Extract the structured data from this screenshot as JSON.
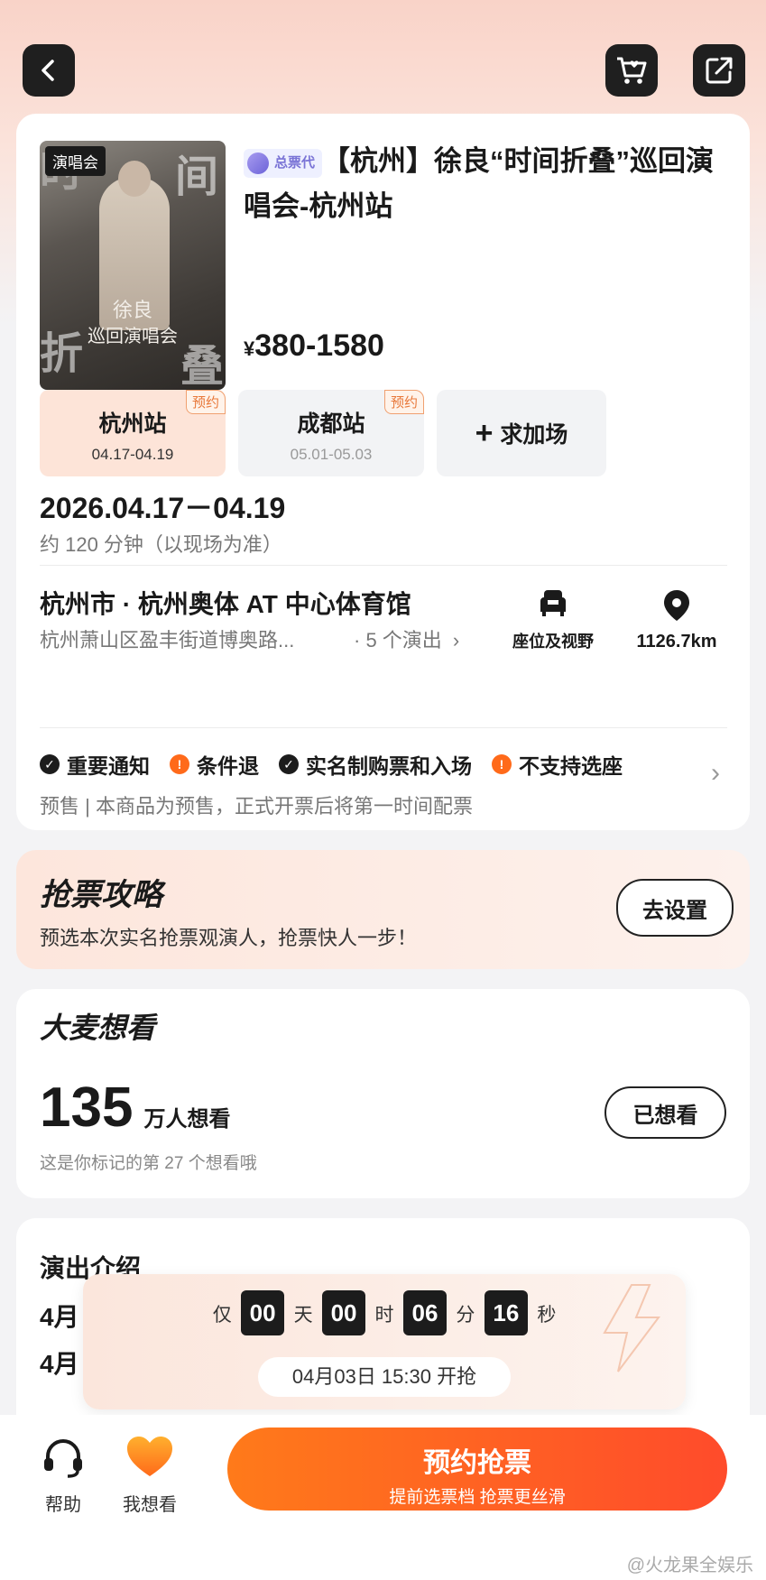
{
  "colors": {
    "accent": "#ff6a1a",
    "accent_light": "#fde4d8",
    "dark": "#1c1c1c",
    "gray": "#777777"
  },
  "nav": {
    "back_icon": "chevron-left-icon",
    "cart_icon": "cart-icon",
    "share_icon": "share-icon"
  },
  "event": {
    "poster_tag": "演唱会",
    "poster_name": "徐良",
    "poster_subtitle": "巡回演唱会",
    "poster_char_1": "间",
    "poster_char_2": "折",
    "poster_char_3": "叠",
    "badge": "总票代",
    "title": "【杭州】徐良“时间折叠”巡回演唱会-杭州站",
    "price_symbol": "¥",
    "price_range": "380-1580"
  },
  "cities": [
    {
      "name": "杭州站",
      "dates": "04.17-04.19",
      "tag": "预约",
      "selected": true
    },
    {
      "name": "成都站",
      "dates": "05.01-05.03",
      "tag": "预约",
      "selected": false
    }
  ],
  "add_show_label": "求加场",
  "schedule": {
    "date_range": "2026.04.17－04.19",
    "duration": "约 120 分钟（以现场为准）"
  },
  "venue": {
    "name": "杭州市 · 杭州奥体 AT 中心体育馆",
    "address": "杭州萧山区盈丰街道博奥路...",
    "shows": "· 5 个演出",
    "seat_label": "座位及视野",
    "distance": "1126.7km"
  },
  "notices": [
    {
      "label": "重要通知",
      "type": "check"
    },
    {
      "label": "条件退",
      "type": "warn"
    },
    {
      "label": "实名制购票和入场",
      "type": "check"
    },
    {
      "label": "不支持选座",
      "type": "warn"
    }
  ],
  "presale_text": "预售 | 本商品为预售，正式开票后将第一时间配票",
  "strategy": {
    "title": "抢票攻略",
    "desc": "预选本次实名抢票观演人，抢票快人一步！",
    "button": "去设置"
  },
  "want": {
    "title": "大麦想看",
    "count": "135",
    "count_unit": "万人想看",
    "note": "这是你标记的第 27 个想看哦",
    "button": "已想看"
  },
  "intro": {
    "title": "演出介绍",
    "line1_prefix": "4月",
    "line2_prefix": "4月"
  },
  "countdown": {
    "prefix": "仅",
    "days": "00",
    "days_unit": "天",
    "hours": "00",
    "hours_unit": "时",
    "minutes": "06",
    "minutes_unit": "分",
    "seconds": "16",
    "seconds_unit": "秒",
    "start_time": "04月03日 15:30 开抢"
  },
  "bottom": {
    "help_label": "帮助",
    "want_label": "我想看",
    "cta_title": "预约抢票",
    "cta_subtitle": "提前选票档 抢票更丝滑"
  },
  "watermark": "@火龙果全娱乐"
}
